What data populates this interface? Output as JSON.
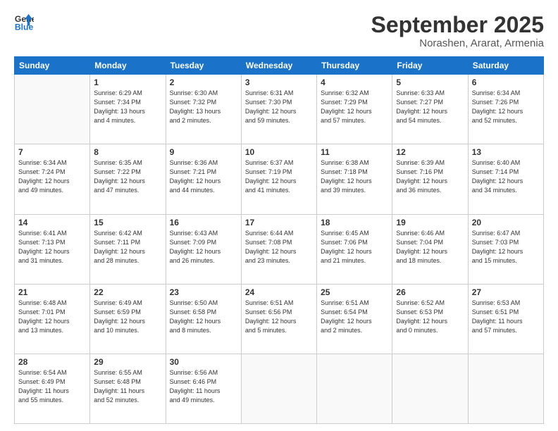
{
  "header": {
    "logo_line1": "General",
    "logo_line2": "Blue",
    "month": "September 2025",
    "location": "Norashen, Ararat, Armenia"
  },
  "days_of_week": [
    "Sunday",
    "Monday",
    "Tuesday",
    "Wednesday",
    "Thursday",
    "Friday",
    "Saturday"
  ],
  "weeks": [
    [
      {
        "day": "",
        "content": ""
      },
      {
        "day": "1",
        "content": "Sunrise: 6:29 AM\nSunset: 7:34 PM\nDaylight: 13 hours\nand 4 minutes."
      },
      {
        "day": "2",
        "content": "Sunrise: 6:30 AM\nSunset: 7:32 PM\nDaylight: 13 hours\nand 2 minutes."
      },
      {
        "day": "3",
        "content": "Sunrise: 6:31 AM\nSunset: 7:30 PM\nDaylight: 12 hours\nand 59 minutes."
      },
      {
        "day": "4",
        "content": "Sunrise: 6:32 AM\nSunset: 7:29 PM\nDaylight: 12 hours\nand 57 minutes."
      },
      {
        "day": "5",
        "content": "Sunrise: 6:33 AM\nSunset: 7:27 PM\nDaylight: 12 hours\nand 54 minutes."
      },
      {
        "day": "6",
        "content": "Sunrise: 6:34 AM\nSunset: 7:26 PM\nDaylight: 12 hours\nand 52 minutes."
      }
    ],
    [
      {
        "day": "7",
        "content": "Sunrise: 6:34 AM\nSunset: 7:24 PM\nDaylight: 12 hours\nand 49 minutes."
      },
      {
        "day": "8",
        "content": "Sunrise: 6:35 AM\nSunset: 7:22 PM\nDaylight: 12 hours\nand 47 minutes."
      },
      {
        "day": "9",
        "content": "Sunrise: 6:36 AM\nSunset: 7:21 PM\nDaylight: 12 hours\nand 44 minutes."
      },
      {
        "day": "10",
        "content": "Sunrise: 6:37 AM\nSunset: 7:19 PM\nDaylight: 12 hours\nand 41 minutes."
      },
      {
        "day": "11",
        "content": "Sunrise: 6:38 AM\nSunset: 7:18 PM\nDaylight: 12 hours\nand 39 minutes."
      },
      {
        "day": "12",
        "content": "Sunrise: 6:39 AM\nSunset: 7:16 PM\nDaylight: 12 hours\nand 36 minutes."
      },
      {
        "day": "13",
        "content": "Sunrise: 6:40 AM\nSunset: 7:14 PM\nDaylight: 12 hours\nand 34 minutes."
      }
    ],
    [
      {
        "day": "14",
        "content": "Sunrise: 6:41 AM\nSunset: 7:13 PM\nDaylight: 12 hours\nand 31 minutes."
      },
      {
        "day": "15",
        "content": "Sunrise: 6:42 AM\nSunset: 7:11 PM\nDaylight: 12 hours\nand 28 minutes."
      },
      {
        "day": "16",
        "content": "Sunrise: 6:43 AM\nSunset: 7:09 PM\nDaylight: 12 hours\nand 26 minutes."
      },
      {
        "day": "17",
        "content": "Sunrise: 6:44 AM\nSunset: 7:08 PM\nDaylight: 12 hours\nand 23 minutes."
      },
      {
        "day": "18",
        "content": "Sunrise: 6:45 AM\nSunset: 7:06 PM\nDaylight: 12 hours\nand 21 minutes."
      },
      {
        "day": "19",
        "content": "Sunrise: 6:46 AM\nSunset: 7:04 PM\nDaylight: 12 hours\nand 18 minutes."
      },
      {
        "day": "20",
        "content": "Sunrise: 6:47 AM\nSunset: 7:03 PM\nDaylight: 12 hours\nand 15 minutes."
      }
    ],
    [
      {
        "day": "21",
        "content": "Sunrise: 6:48 AM\nSunset: 7:01 PM\nDaylight: 12 hours\nand 13 minutes."
      },
      {
        "day": "22",
        "content": "Sunrise: 6:49 AM\nSunset: 6:59 PM\nDaylight: 12 hours\nand 10 minutes."
      },
      {
        "day": "23",
        "content": "Sunrise: 6:50 AM\nSunset: 6:58 PM\nDaylight: 12 hours\nand 8 minutes."
      },
      {
        "day": "24",
        "content": "Sunrise: 6:51 AM\nSunset: 6:56 PM\nDaylight: 12 hours\nand 5 minutes."
      },
      {
        "day": "25",
        "content": "Sunrise: 6:51 AM\nSunset: 6:54 PM\nDaylight: 12 hours\nand 2 minutes."
      },
      {
        "day": "26",
        "content": "Sunrise: 6:52 AM\nSunset: 6:53 PM\nDaylight: 12 hours\nand 0 minutes."
      },
      {
        "day": "27",
        "content": "Sunrise: 6:53 AM\nSunset: 6:51 PM\nDaylight: 11 hours\nand 57 minutes."
      }
    ],
    [
      {
        "day": "28",
        "content": "Sunrise: 6:54 AM\nSunset: 6:49 PM\nDaylight: 11 hours\nand 55 minutes."
      },
      {
        "day": "29",
        "content": "Sunrise: 6:55 AM\nSunset: 6:48 PM\nDaylight: 11 hours\nand 52 minutes."
      },
      {
        "day": "30",
        "content": "Sunrise: 6:56 AM\nSunset: 6:46 PM\nDaylight: 11 hours\nand 49 minutes."
      },
      {
        "day": "",
        "content": ""
      },
      {
        "day": "",
        "content": ""
      },
      {
        "day": "",
        "content": ""
      },
      {
        "day": "",
        "content": ""
      }
    ]
  ]
}
